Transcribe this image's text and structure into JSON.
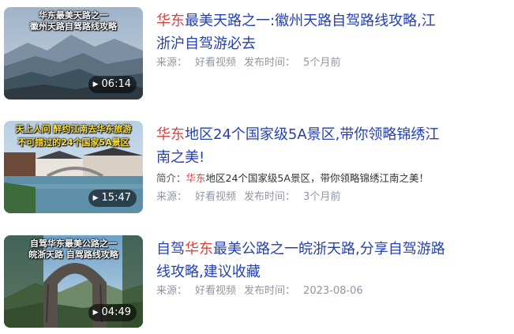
{
  "results": [
    {
      "thumb_caption": [
        "华东最美天路之一",
        "徽州天路自驾路线攻略"
      ],
      "duration": "06:14",
      "title_line1": [
        "华东",
        "最美天路之一:徽州天路自驾路线攻略,江"
      ],
      "title_line2": [
        "",
        "浙沪自驾游必去"
      ],
      "source_label": "来源：",
      "source": "好看视频",
      "time_label": "发布时间：",
      "time": "5个月前"
    },
    {
      "thumb_caption": [
        "天上人间 醉约江南去华东旅游",
        "不可错过的24个国家5A景区"
      ],
      "duration": "15:47",
      "title_line1": [
        "华东",
        "地区24个国家级5A景区,带你领略锦绣江"
      ],
      "title_line2": [
        "",
        "南之美!"
      ],
      "desc_label": "简介：",
      "desc_hl": "华东",
      "desc_text": "地区24个国家级5A景区，带你领略锦绣江南之美！",
      "source_label": "来源：",
      "source": "好看视频",
      "time_label": "发布时间：",
      "time": "3个月前"
    },
    {
      "thumb_caption": [
        "自驾华东最美公路之一",
        "皖浙天路 自驾路线攻略"
      ],
      "duration": "04:49",
      "title_prefix": "自驾",
      "title_line1": [
        "华东",
        "最美公路之一皖浙天路,分享自驾游路"
      ],
      "title_line2": [
        "",
        "线攻略,建议收藏"
      ],
      "source_label": "来源：",
      "source": "好看视频",
      "time_label": "发布时间：",
      "time": "2023-08-06"
    }
  ],
  "icons": {
    "play": "play-icon"
  },
  "colors": {
    "title": "#2440b3",
    "highlight": "#e43f3f",
    "meta": "#9195a3"
  }
}
